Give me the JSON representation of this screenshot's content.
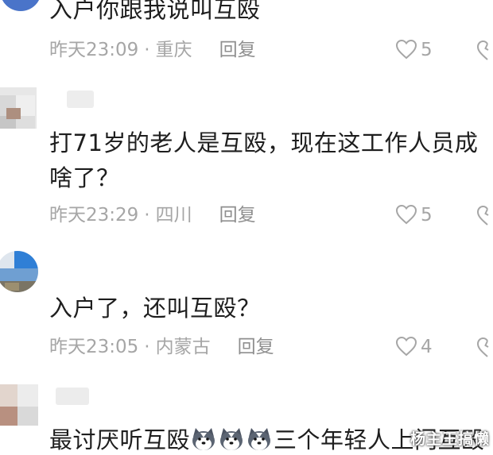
{
  "comments": [
    {
      "text": "入户你跟我说叫互殴",
      "time": "昨天23:09",
      "location": "重庆",
      "reply": "回复",
      "likes": "5"
    },
    {
      "text": "打71岁的老人是互殴，现在这工作人员成\n啥了？",
      "time": "昨天23:29",
      "location": "四川",
      "reply": "回复",
      "likes": "5"
    },
    {
      "text": "入户了，还叫互殴？",
      "time": "昨天23:05",
      "location": "内蒙古",
      "reply": "回复",
      "likes": "4"
    },
    {
      "text_before": "最讨厌听互殴",
      "text_after": "三个年轻人上门互殴",
      "emoji": "husky-dog-face-icon"
    }
  ],
  "separator": "·",
  "watermark": "杨主王搞懒",
  "colors": {
    "text": "#1e1e1e",
    "meta": "#a6a6a6",
    "background": "#ffffff"
  },
  "icons": [
    "heart-outline-icon",
    "dislike-icon",
    "husky-dog-face-icon"
  ]
}
